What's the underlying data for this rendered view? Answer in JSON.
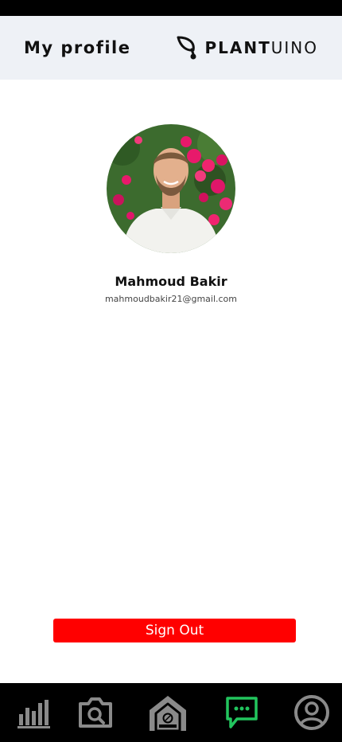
{
  "header": {
    "title": "My profile",
    "brand_bold": "PLANT",
    "brand_light": "UINO"
  },
  "profile": {
    "name": "Mahmoud Bakir",
    "email": "mahmoudbakir21@gmail.com"
  },
  "actions": {
    "sign_out_label": "Sign Out"
  },
  "nav": {
    "items": [
      {
        "icon": "bar-chart-icon",
        "active": false
      },
      {
        "icon": "camera-search-icon",
        "active": false
      },
      {
        "icon": "greenhouse-icon",
        "active": false
      },
      {
        "icon": "chat-icon",
        "active": true
      },
      {
        "icon": "user-circle-icon",
        "active": false
      }
    ]
  },
  "colors": {
    "header_bg": "#eef1f6",
    "sign_out_bg": "#ff0000",
    "nav_bg": "#000000",
    "nav_icon": "#8a8a8a",
    "nav_active": "#22c55e"
  }
}
